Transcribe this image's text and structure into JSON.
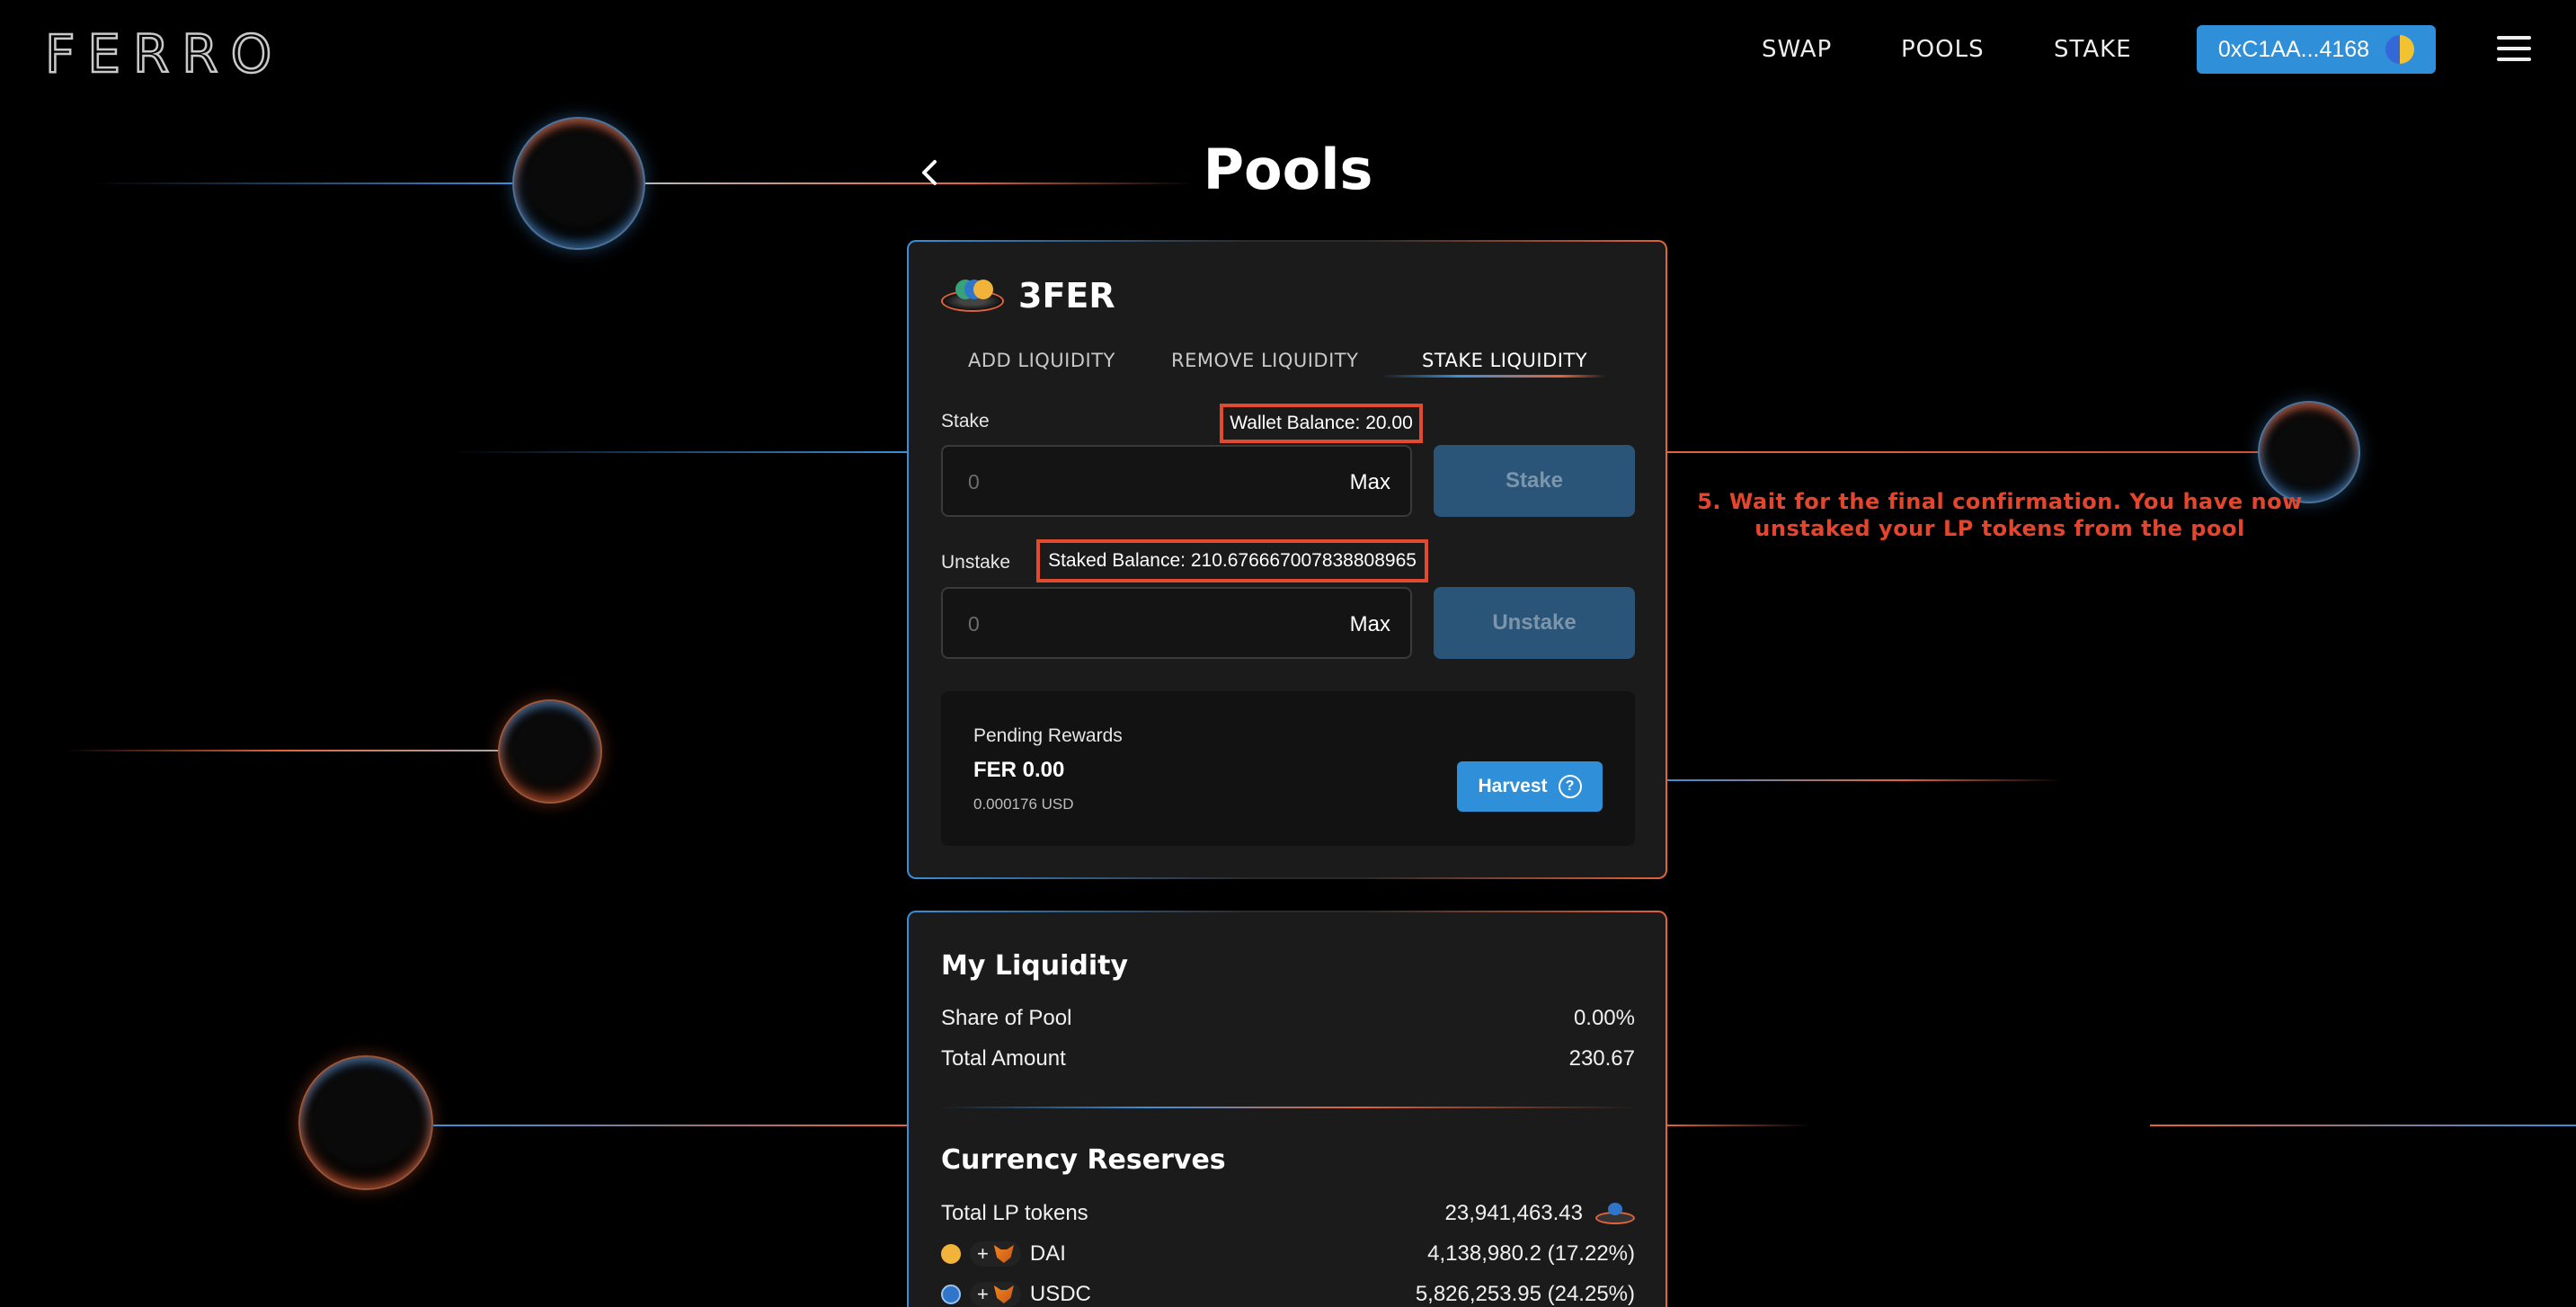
{
  "header": {
    "logo": "FERRO",
    "nav": [
      "SWAP",
      "POOLS",
      "STAKE"
    ],
    "wallet_label": "0xC1AA...4168"
  },
  "page": {
    "title": "Pools"
  },
  "pool": {
    "name": "3FER",
    "tabs": [
      "ADD LIQUIDITY",
      "REMOVE LIQUIDITY",
      "STAKE LIQUIDITY"
    ],
    "active_tab": "STAKE LIQUIDITY",
    "stake": {
      "label": "Stake",
      "wallet_balance": "Wallet Balance: 20.00",
      "input_value": "0",
      "max_label": "Max",
      "button": "Stake"
    },
    "unstake": {
      "label": "Unstake",
      "staked_balance": "Staked Balance: 210.676667007838808965",
      "input_value": "0",
      "max_label": "Max",
      "button": "Unstake"
    },
    "rewards": {
      "title": "Pending Rewards",
      "amount": "FER 0.00",
      "usd": "0.000176 USD",
      "button": "Harvest",
      "help_glyph": "?"
    }
  },
  "my_liquidity": {
    "title": "My Liquidity",
    "share_label": "Share of Pool",
    "share_value": "0.00%",
    "total_label": "Total Amount",
    "total_value": "230.67"
  },
  "reserves": {
    "title": "Currency Reserves",
    "lp_label": "Total LP tokens",
    "lp_value": "23,941,463.43",
    "plus": "+",
    "rows": [
      {
        "token": "DAI",
        "value": "4,138,980.2 (17.22%)"
      },
      {
        "token": "USDC",
        "value": "5,826,253.95 (24.25%)"
      }
    ]
  },
  "annotation": {
    "line1": "5. Wait for the final confirmation. You have now",
    "line2": "unstaked your LP tokens from the pool"
  },
  "colors": {
    "accent_blue": "#2f8fd8",
    "accent_orange": "#e2633c",
    "highlight_red": "#e24a2e"
  }
}
